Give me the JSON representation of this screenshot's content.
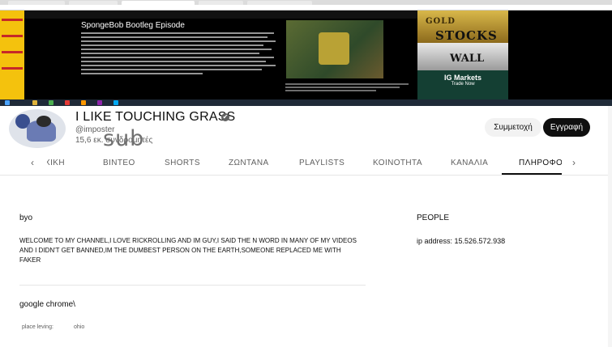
{
  "banner": {
    "wiki_title": "SpongeBob Bootleg Episode",
    "ad_words": [
      "GOLD",
      "STOCKS",
      "WALL"
    ],
    "ad_brand": "IG Markets",
    "ad_cta": "Trade Now"
  },
  "channel": {
    "title": "I LIKE TOUCHING GRASS",
    "handle": "@imposter",
    "subscribers": "15,6 εκ. συνδρομητές",
    "overlay_text": "sub",
    "join_label": "Συμμετοχή",
    "subscribe_label": "Εγγραφή"
  },
  "tabs": [
    {
      "label": "ΑΡΧΙΚΗ"
    },
    {
      "label": "ΒΙΝΤΕΟ"
    },
    {
      "label": "SHORTS"
    },
    {
      "label": "ΖΩΝΤΑΝΑ"
    },
    {
      "label": "PLAYLISTS"
    },
    {
      "label": "ΚΟΙΝΟΤΗΤΑ"
    },
    {
      "label": "ΚΑΝΑΛΙΑ"
    },
    {
      "label": "ΠΛΗΡΟΦΟΡΙΕΣ"
    }
  ],
  "about": {
    "label": "byo",
    "description": "WELCOME TO MY CHANNEL,I LOVE RICKROLLING AND IM GUY,I SAID THE N WORD IN MANY OF MY VIDEOS AND I DIDN'T GET BANNED,IM THE DUMBEST PERSON ON THE EARTH,SOMEONE REPLACED ME WITH FAKER",
    "link_text": "google chrome\\",
    "place_label": "place leving:",
    "place_value": "ohio"
  },
  "sidebar": {
    "heading": "PEOPLE",
    "ip_text": "ip address: 15.526.572.938"
  },
  "colors": {
    "subscribe_bg": "#0f0f0f",
    "join_bg": "#f2f2f2",
    "muted_text": "#606060"
  }
}
